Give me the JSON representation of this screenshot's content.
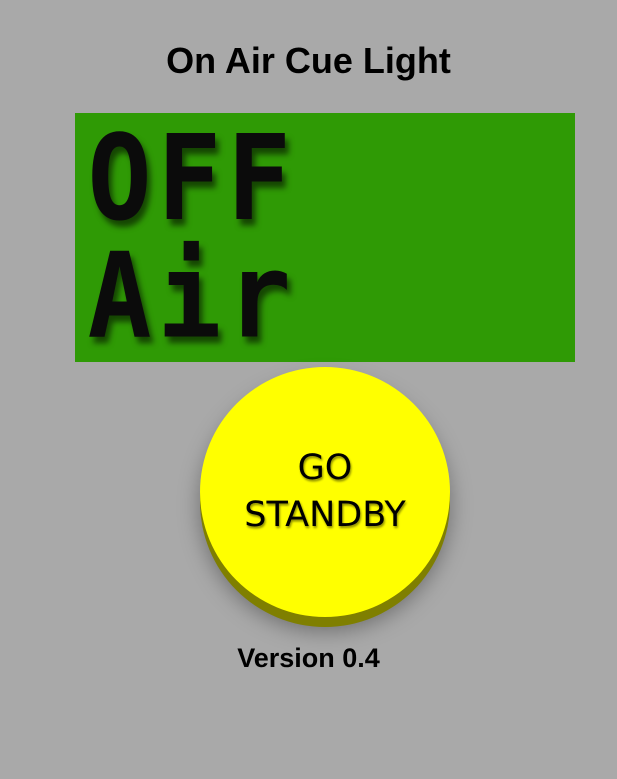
{
  "page": {
    "title": "On Air Cue Light",
    "background_color": "#a9a9a9"
  },
  "status_panel": {
    "text": "OFF Air",
    "background_color": "#2f9a05",
    "text_color": "#0b0b0b"
  },
  "cue_button": {
    "line1": "GO",
    "line2": "STANDBY",
    "color": "#ffff00",
    "shadow_color": "#7f7f00"
  },
  "footer": {
    "version": "Version 0.4"
  }
}
